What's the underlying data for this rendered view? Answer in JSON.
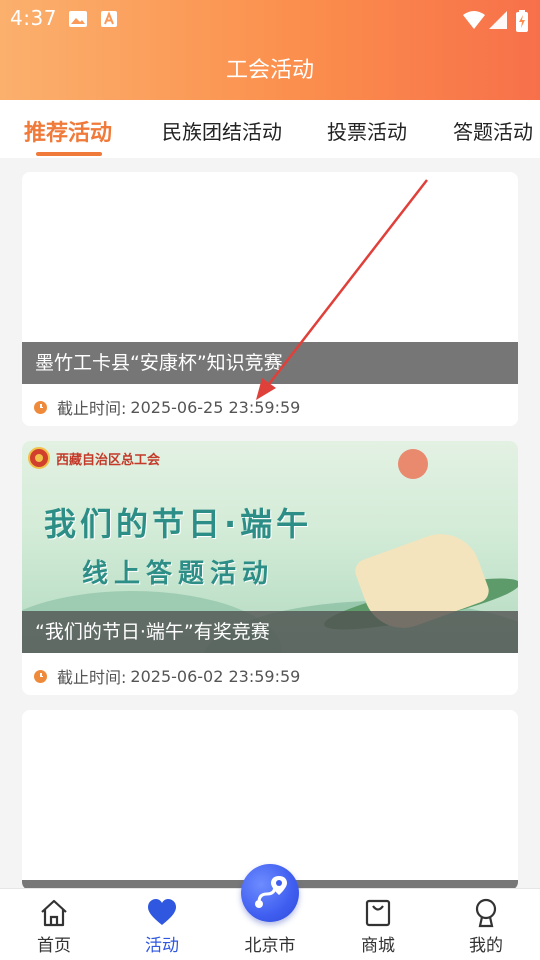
{
  "status_bar": {
    "time": "4:37"
  },
  "header": {
    "title": "工会活动"
  },
  "tabs": [
    {
      "label": "推荐活动",
      "active": true
    },
    {
      "label": "民族团结活动",
      "active": false
    },
    {
      "label": "投票活动",
      "active": false
    },
    {
      "label": "答题活动",
      "active": false
    }
  ],
  "cards": [
    {
      "title": "墨竹工卡县“安康杯”知识竞赛",
      "deadline_label": "截止时间:",
      "deadline": "2025-06-25 23:59:59"
    },
    {
      "title": "“我们的节日·端午”有奖竞赛",
      "deadline_label": "截止时间:",
      "deadline": "2025-06-02 23:59:59",
      "banner": {
        "org": "西藏自治区总工会",
        "line1": "我们的节日·端午",
        "line2": "线上答题活动"
      }
    }
  ],
  "bottom_nav": [
    {
      "label": "首页",
      "icon": "home-icon",
      "active": false
    },
    {
      "label": "活动",
      "icon": "heart-icon",
      "active": true
    },
    {
      "label": "北京市",
      "icon": "location-route-icon",
      "active": false
    },
    {
      "label": "商城",
      "icon": "shopping-bag-icon",
      "active": false
    },
    {
      "label": "我的",
      "icon": "user-icon",
      "active": false
    }
  ],
  "colors": {
    "accent": "#f07a3a",
    "nav_active": "#2f57e0",
    "arrow": "#e0403a"
  }
}
